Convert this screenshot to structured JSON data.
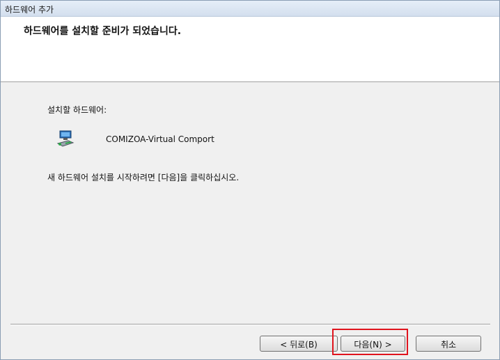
{
  "window": {
    "title": "하드웨어 추가",
    "heading": "하드웨어를 설치할 준비가 되었습니다."
  },
  "content": {
    "hardware_label": "설치할 하드웨어:",
    "hardware_name": "COMIZOA-Virtual Comport",
    "hardware_icon": "network-adapter-icon",
    "instruction": "새 하드웨어 설치를 시작하려면 [다음]을 클릭하십시오."
  },
  "buttons": {
    "back": "< 뒤로(B)",
    "next": "다음(N) >",
    "cancel": "취소"
  },
  "colors": {
    "highlight": "#e0141e"
  }
}
